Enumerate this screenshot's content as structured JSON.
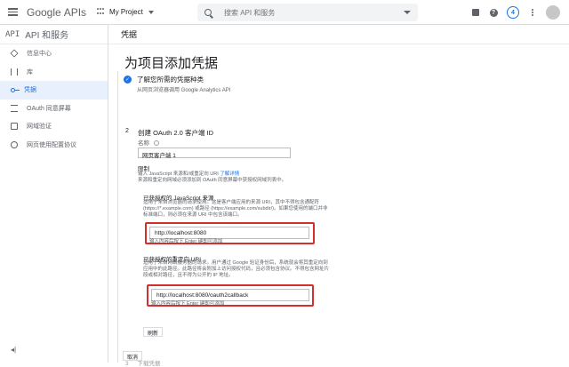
{
  "header": {
    "logo_google": "Google",
    "logo_apis": "APIs",
    "project": "My Project",
    "search_placeholder": "搜索 API 和服务",
    "notification_count": "4"
  },
  "sidebar": {
    "title_api": "API",
    "title": "API 和服务",
    "items": [
      {
        "label": "信息中心",
        "icon": "dashboard-icon"
      },
      {
        "label": "库",
        "icon": "library-icon"
      },
      {
        "label": "凭据",
        "icon": "key-icon"
      },
      {
        "label": "OAuth 同意屏幕",
        "icon": "list-icon"
      },
      {
        "label": "网域验证",
        "icon": "check-icon"
      },
      {
        "label": "网页使用配置协议",
        "icon": "settings-icon"
      }
    ],
    "collapse": "◂|"
  },
  "main": {
    "breadcrumb": "凭据",
    "title": "为项目添加凭据",
    "step1": {
      "title": "了解您所需的凭据种类",
      "subtitle": "从网页浏览器调用 Google Analytics API"
    },
    "step2": {
      "number": "2",
      "title": "创建 OAuth 2.0 客户端 ID",
      "name_label": "名称",
      "name_value": "网页客户端 1",
      "restrictions_label": "限制",
      "restrictions_text": "输入 JavaScript 来源和/或重定向 URI",
      "restrictions_link": "了解详情",
      "restrictions_text2": "来源和重定向网域必须添加到 OAuth 同意屏幕中获授权网域列表中。",
      "js_origins_label": "已获授权的 JavaScript 来源",
      "js_origins_help": "适用于来自浏览器的请求使用。这是客户端应用的来源 URI，其中不得包含通配符 (https://*.example.com) 或路径 (https://example.com/subdir/)。如果您使用的端口并非标准端口，则必须在来源 URI 中包含该端口。",
      "js_origin_value": "http://localhost:8080",
      "js_origin_hint": "输入内容后按下 Enter 键即可添加",
      "redirect_label": "已获授权的重定向 URI",
      "redirect_help": "适用于来自网络服务器的请求。用户通过 Google 验证身份后，系统就会将其重定向到应用中的此路径。此路径将会附加上访问授权代码，且必须包含协议。不得包含网址片段或相对路径，且不得为公开的 IP 地址。",
      "redirect_value": "http://localhost:8080/oauth2callback",
      "redirect_hint": "输入内容后按下 Enter 键即可添加",
      "refresh_button": "刷新"
    },
    "step3": {
      "number": "3",
      "title": "下载凭据"
    },
    "cancel_button": "取消"
  }
}
